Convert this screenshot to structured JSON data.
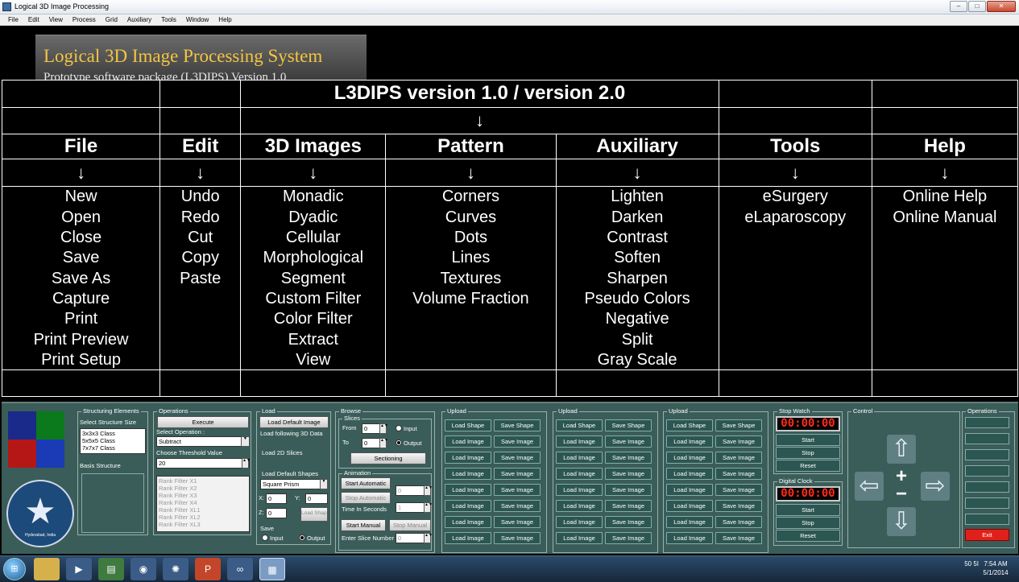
{
  "window": {
    "title": "Logical 3D Image Processing",
    "controls": [
      "–",
      "□",
      "✕"
    ]
  },
  "menu": [
    "File",
    "Edit",
    "View",
    "Process",
    "Grid",
    "Auxiliary",
    "Tools",
    "Window",
    "Help"
  ],
  "banner": {
    "title": "Logical 3D Image Processing System",
    "subtitle": "Prototype software package (L3DIPS) Version 1.0"
  },
  "chart": {
    "title": "L3DIPS version 1.0 / version 2.0",
    "arrow": "↓",
    "columns": [
      {
        "header": "File",
        "items": [
          "New",
          "Open",
          "Close",
          "Save",
          "Save As",
          "Capture",
          "Print",
          "Print Preview",
          "Print Setup"
        ]
      },
      {
        "header": "Edit",
        "items": [
          "Undo",
          "Redo",
          "Cut",
          "Copy",
          "Paste"
        ]
      },
      {
        "header": "3D Images",
        "items": [
          "Monadic",
          "Dyadic",
          "Cellular",
          "Morphological",
          "Segment",
          "Custom Filter",
          "Color Filter",
          "Extract",
          "View"
        ]
      },
      {
        "header": "Pattern",
        "items": [
          "Corners",
          "Curves",
          "Dots",
          "Lines",
          "Textures",
          "Volume Fraction"
        ]
      },
      {
        "header": "Auxiliary",
        "items": [
          "Lighten",
          "Darken",
          "Contrast",
          "Soften",
          "Sharpen",
          "Pseudo Colors",
          "Negative",
          "Split",
          "Gray Scale"
        ]
      },
      {
        "header": "Tools",
        "items": [
          "eSurgery",
          "eLaparoscopy"
        ]
      },
      {
        "header": "Help",
        "items": [
          "Online Help",
          "Online Manual"
        ]
      }
    ]
  },
  "panel": {
    "struct": {
      "label": "Structuring Elements",
      "size_label": "Select Structure Size",
      "sizes": [
        "3x3x3 Class",
        "5x5x5 Class",
        "7x7x7 Class"
      ],
      "basis_label": "Basis Structure",
      "logo_text": "Hyderabad, India"
    },
    "operations": {
      "label": "Operations",
      "execute": "Execute",
      "select_label": "Select Operation :",
      "select_value": "Subtract",
      "threshold_label": "Choose Threshold Value",
      "threshold_value": "20",
      "filters": [
        "Rank Filter X1",
        "Rank Filter X2",
        "Rank Filter X3",
        "Rank Filter X4",
        "Rank Filter XL1",
        "Rank Filter XL2",
        "Rank Filter XL3"
      ]
    },
    "load": {
      "label": "Load",
      "default_image": "Load Default Image",
      "following": "Load following 3D Data",
      "slices_2d": "Load 2D Slices",
      "default_shapes": "Load Default Shapes",
      "shape_value": "Square Prism",
      "x_label": "X:",
      "x_value": "0",
      "y_label": "Y:",
      "y_value": "0",
      "z_label": "Z:",
      "z_value": "0",
      "load_shape_btn": "Load Shapes",
      "save_label": "Save",
      "input": "Input",
      "output": "Output"
    },
    "browse": {
      "label": "Browse",
      "slices_label": "Slices",
      "from_label": "From",
      "from_value": "0",
      "to_label": "To",
      "to_value": "0",
      "input": "Input",
      "output": "Output",
      "sectioning": "Sectioning",
      "animation_label": "Animation",
      "start_auto": "Start Automatic",
      "stop_auto": "Stop Automatic",
      "auto_value": "0",
      "time_label": "Time In Seconds",
      "time_value": "1",
      "start_manual": "Start Manual",
      "stop_manual": "Stop Manual",
      "slice_label": "Enter Slice Number",
      "slice_value": "0"
    },
    "upload_groups": [
      {
        "label": "Upload",
        "rows": [
          [
            "Load Shape",
            "Save Shape"
          ],
          [
            "Load Image",
            "Save Image"
          ],
          [
            "Load Image",
            "Save Image"
          ],
          [
            "Load Image",
            "Save Image"
          ],
          [
            "Load Image",
            "Save Image"
          ],
          [
            "Load Image",
            "Save Image"
          ],
          [
            "Load Image",
            "Save Image"
          ],
          [
            "Load Image",
            "Save Image"
          ]
        ]
      },
      {
        "label": "Upload",
        "rows": [
          [
            "Load Shape",
            "Save Shape"
          ],
          [
            "Load Image",
            "Save Image"
          ],
          [
            "Load Image",
            "Save Image"
          ],
          [
            "Load Image",
            "Save Image"
          ],
          [
            "Load Image",
            "Save Image"
          ],
          [
            "Load Image",
            "Save Image"
          ],
          [
            "Load Image",
            "Save Image"
          ],
          [
            "Load Image",
            "Save Image"
          ]
        ]
      },
      {
        "label": "Upload",
        "rows": [
          [
            "Load Shape",
            "Save Shape"
          ],
          [
            "Load Image",
            "Save Image"
          ],
          [
            "Load Image",
            "Save Image"
          ],
          [
            "Load Image",
            "Save Image"
          ],
          [
            "Load Image",
            "Save Image"
          ],
          [
            "Load Image",
            "Save Image"
          ],
          [
            "Load Image",
            "Save Image"
          ],
          [
            "Load Image",
            "Save Image"
          ]
        ]
      }
    ],
    "stopwatch": {
      "label": "Stop Watch",
      "display": "00:00:00",
      "start": "Start",
      "stop": "Stop",
      "reset": "Reset"
    },
    "digital_clock": {
      "label": "Digital Clock",
      "display": "00:00:00",
      "start": "Start",
      "stop": "Stop",
      "reset": "Reset"
    },
    "control": {
      "label": "Control",
      "up": "⇧",
      "down": "⇩",
      "left": "⇦",
      "right": "⇨",
      "plus": "+",
      "minus": "−"
    },
    "ops_right": {
      "label": "Operations",
      "exit": "Exit"
    }
  },
  "taskbar": {
    "start": "⊞",
    "apps": [
      "explorer",
      "media",
      "chart",
      "chrome",
      "settings",
      "powerpoint",
      "network",
      "app"
    ],
    "tray": "50  5I",
    "time": "7:54 AM",
    "date": "5/1/2014"
  },
  "colors": {
    "panel": "#3a5d59",
    "clock_red": "#ff2a1a",
    "exit_red": "#e0201a",
    "banner_gold": "#f3c542"
  }
}
